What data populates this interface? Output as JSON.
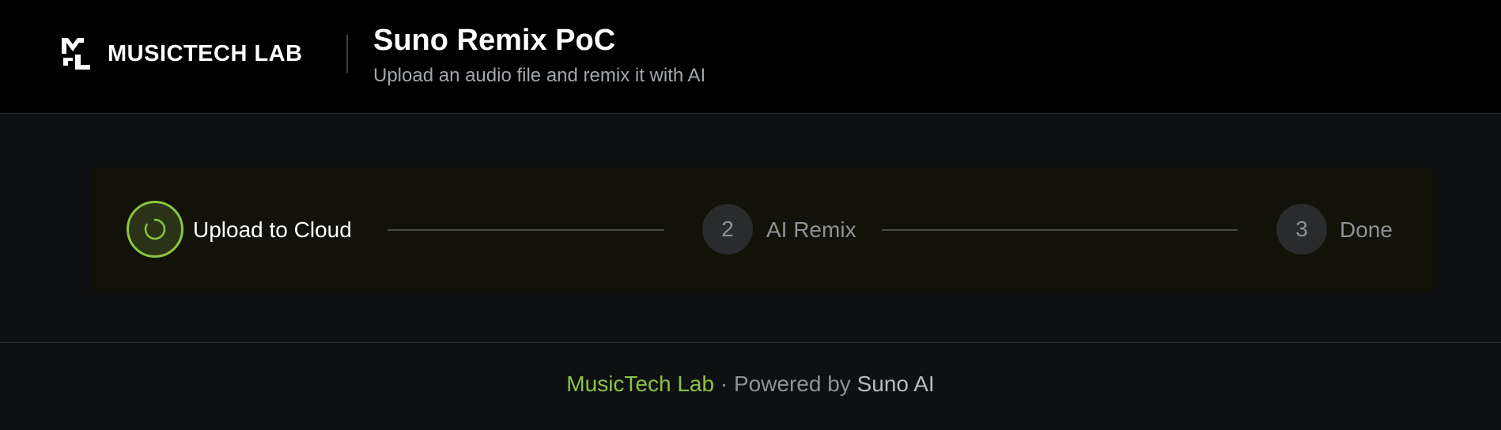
{
  "header": {
    "brand_name": "MUSICTECH LAB",
    "logo_icon": "musictech-logo-icon",
    "title": "Suno Remix PoC",
    "subtitle": "Upload an audio file and remix it with AI"
  },
  "stepper": {
    "steps": [
      {
        "label": "Upload to Cloud",
        "status": "active",
        "icon": "spinner-icon"
      },
      {
        "number": "2",
        "label": "AI Remix",
        "status": "pending"
      },
      {
        "number": "3",
        "label": "Done",
        "status": "pending"
      }
    ]
  },
  "footer": {
    "brand": "MusicTech Lab",
    "separator": " · Powered by ",
    "provider": "Suno AI"
  },
  "colors": {
    "accent": "#8bc43f",
    "header_bg": "#000000",
    "page_bg": "#0e1012",
    "stepper_bg": "#121208",
    "muted_text": "#8e9296"
  }
}
